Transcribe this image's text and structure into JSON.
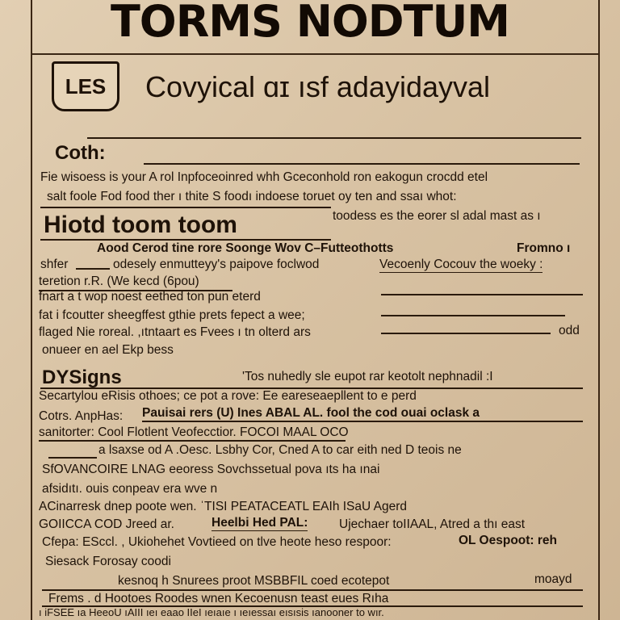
{
  "masthead": "TORMS NODTUM",
  "logo": {
    "text": "LES"
  },
  "subtitle": "Covyical  ɑɪ  ısf adayidayval",
  "section1": {
    "heading": "Coth:",
    "lines": [
      "Fie wisoess is your A rol Inpfoceoinred whh Gceconhold ron eakogun crocdd etel",
      "salt foole Fod food ther ı thite S foodı indoese toruet oy ten and ssaı whot:",
      "toodess es the eorer sl adal mast as ı"
    ]
  },
  "section2": {
    "heading": "Hiotd  toom toom",
    "subhead_left": "Aood Cerod tine rore Soonge Wov C–Futteothotts",
    "subhead_right": "Fromno ı",
    "lines": [
      "shfer",
      "odesely enmutteyy's paipove foclwod",
      "Vecoenly Cocouv the woeky :",
      "teretion r.R. (We kecd (6pou)",
      "fnart a t wop noest eethed ton pun eterd",
      "fat i fcoutter sheegffest gthie prets fepect a wee;",
      "flaged Nie roreal. ,ıtntaart es Fvees ı tn olterd ars",
      "odd",
      "onueer en ael Ekp bess"
    ]
  },
  "section3": {
    "heading": "DYSigns",
    "heading_note": "'Tos nuhedly sle  eupot rar keotolt nephnadil :I",
    "lines": [
      "Secartylou eRisis othoes; ce pot a rove: Ee eareseaepllent to e perd",
      "Cotrs. AnpHas:",
      "Pauisai rers (U) Ines ABAL AL.  fool the cod ouai oclask a",
      "sanitorter: Cool Flotlent   Veofecctior.  FOCOI MAAL OCO",
      "a  lsaxse od A .Oesc. Lsbhy Cor,  Cned A  to car eith ned D teois ne",
      "SfOVANCOIRE LNAG eeoress Sovchssetual pova ıts ha ınai",
      "afsidıtı. ouis conpeav era wve n",
      "ACinarresk dnep poote wen. ˈTISI PEATACEATL EAIh ISaU Agerd",
      "GOIICCA COD Jreed ar.",
      "Heelbi Hed PAL:",
      "Ujechaer toIIAAL, Atred a thı east",
      "Cfepa: ESccl. , Ukiohehet  Vovtieed on tlve heote heso respoor:",
      "OL Oespoot: reh",
      "Siesack  Forosay coodi",
      "kesnoq h Snurees proot MSBBFIL coed ecotepot",
      "moayd",
      "Frems . d Hootoes Roodes wnen Kecoenusn teast eues Rıha",
      "ı iFSEE ıa HeeoU ıAIII ıeı eaao IIeI ıeıaıe ı ıeıessaı eısısis ıanooner to wır."
    ]
  }
}
